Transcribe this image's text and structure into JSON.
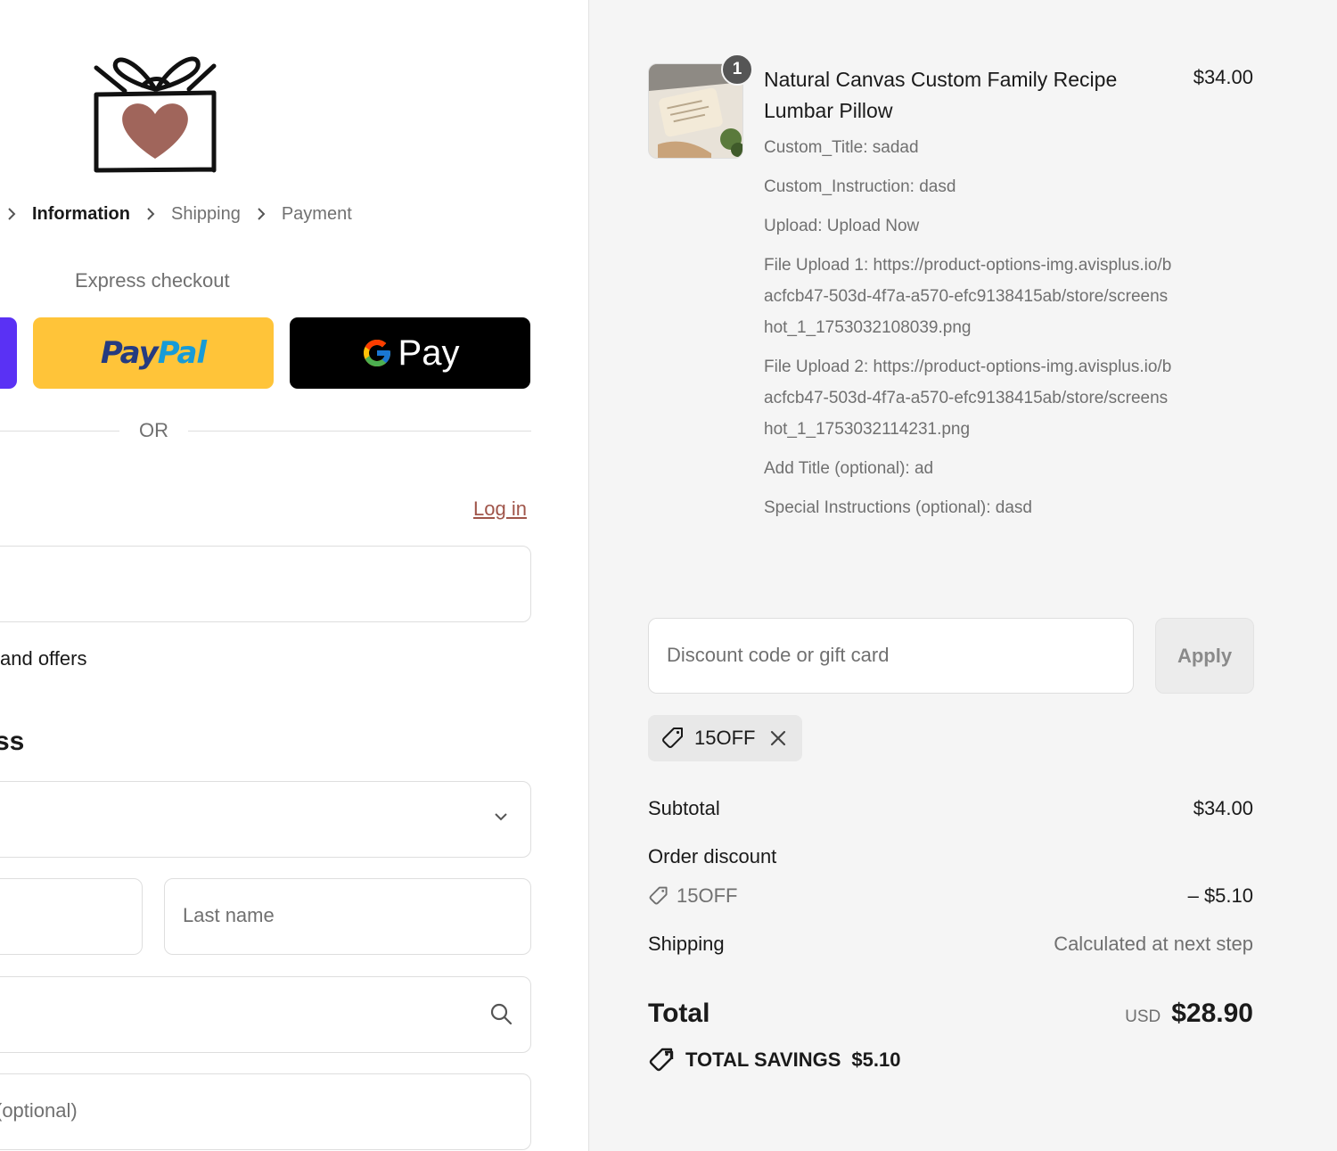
{
  "breadcrumb": {
    "items": [
      "Information",
      "Shipping",
      "Payment"
    ]
  },
  "express": {
    "label": "Express checkout",
    "paypal_a": "Pay",
    "paypal_b": "Pal",
    "gpay_label": "Pay"
  },
  "divider": {
    "label": "OR"
  },
  "contact": {
    "login_label": "Log in",
    "offers_label": "and offers"
  },
  "delivery": {
    "heading": "ss",
    "last_name_placeholder": "Last name",
    "apartment_placeholder": "(optional)"
  },
  "cart": {
    "quantity": "1",
    "product_title": "Natural Canvas Custom Family Recipe Lumbar Pillow",
    "product_price": "$34.00",
    "properties": [
      "Custom_Title: sadad",
      "Custom_Instruction: dasd",
      "Upload: Upload Now",
      "File Upload 1: https://product-options-img.avisplus.io/bacfcb47-503d-4f7a-a570-efc9138415ab/store/screenshot_1_1753032108039.png",
      "File Upload 2: https://product-options-img.avisplus.io/bacfcb47-503d-4f7a-a570-efc9138415ab/store/screenshot_1_1753032114231.png",
      "Add Title (optional): ad",
      "Special Instructions (optional): dasd"
    ]
  },
  "discount": {
    "placeholder": "Discount code or gift card",
    "apply_label": "Apply",
    "applied_code": "15OFF"
  },
  "summary": {
    "subtotal_label": "Subtotal",
    "subtotal_value": "$34.00",
    "order_discount_label": "Order discount",
    "discount_code": "15OFF",
    "discount_value": "– $5.10",
    "shipping_label": "Shipping",
    "shipping_value": "Calculated at next step",
    "total_label": "Total",
    "currency": "USD",
    "total_value": "$28.90",
    "savings_label": "TOTAL SAVINGS",
    "savings_value": "$5.10"
  },
  "colors": {
    "accent_link": "#a0554a",
    "paypal_yellow": "#ffc439",
    "gpay_black": "#000000",
    "shop_purple": "#5a31f4",
    "logo_heart": "#a0655b"
  },
  "icons": [
    "gift-heart-logo",
    "chevron-right-icon",
    "paypal-logo",
    "google-g-icon",
    "chevron-down-icon",
    "search-icon",
    "tag-icon",
    "close-icon",
    "savings-tag-icon"
  ]
}
